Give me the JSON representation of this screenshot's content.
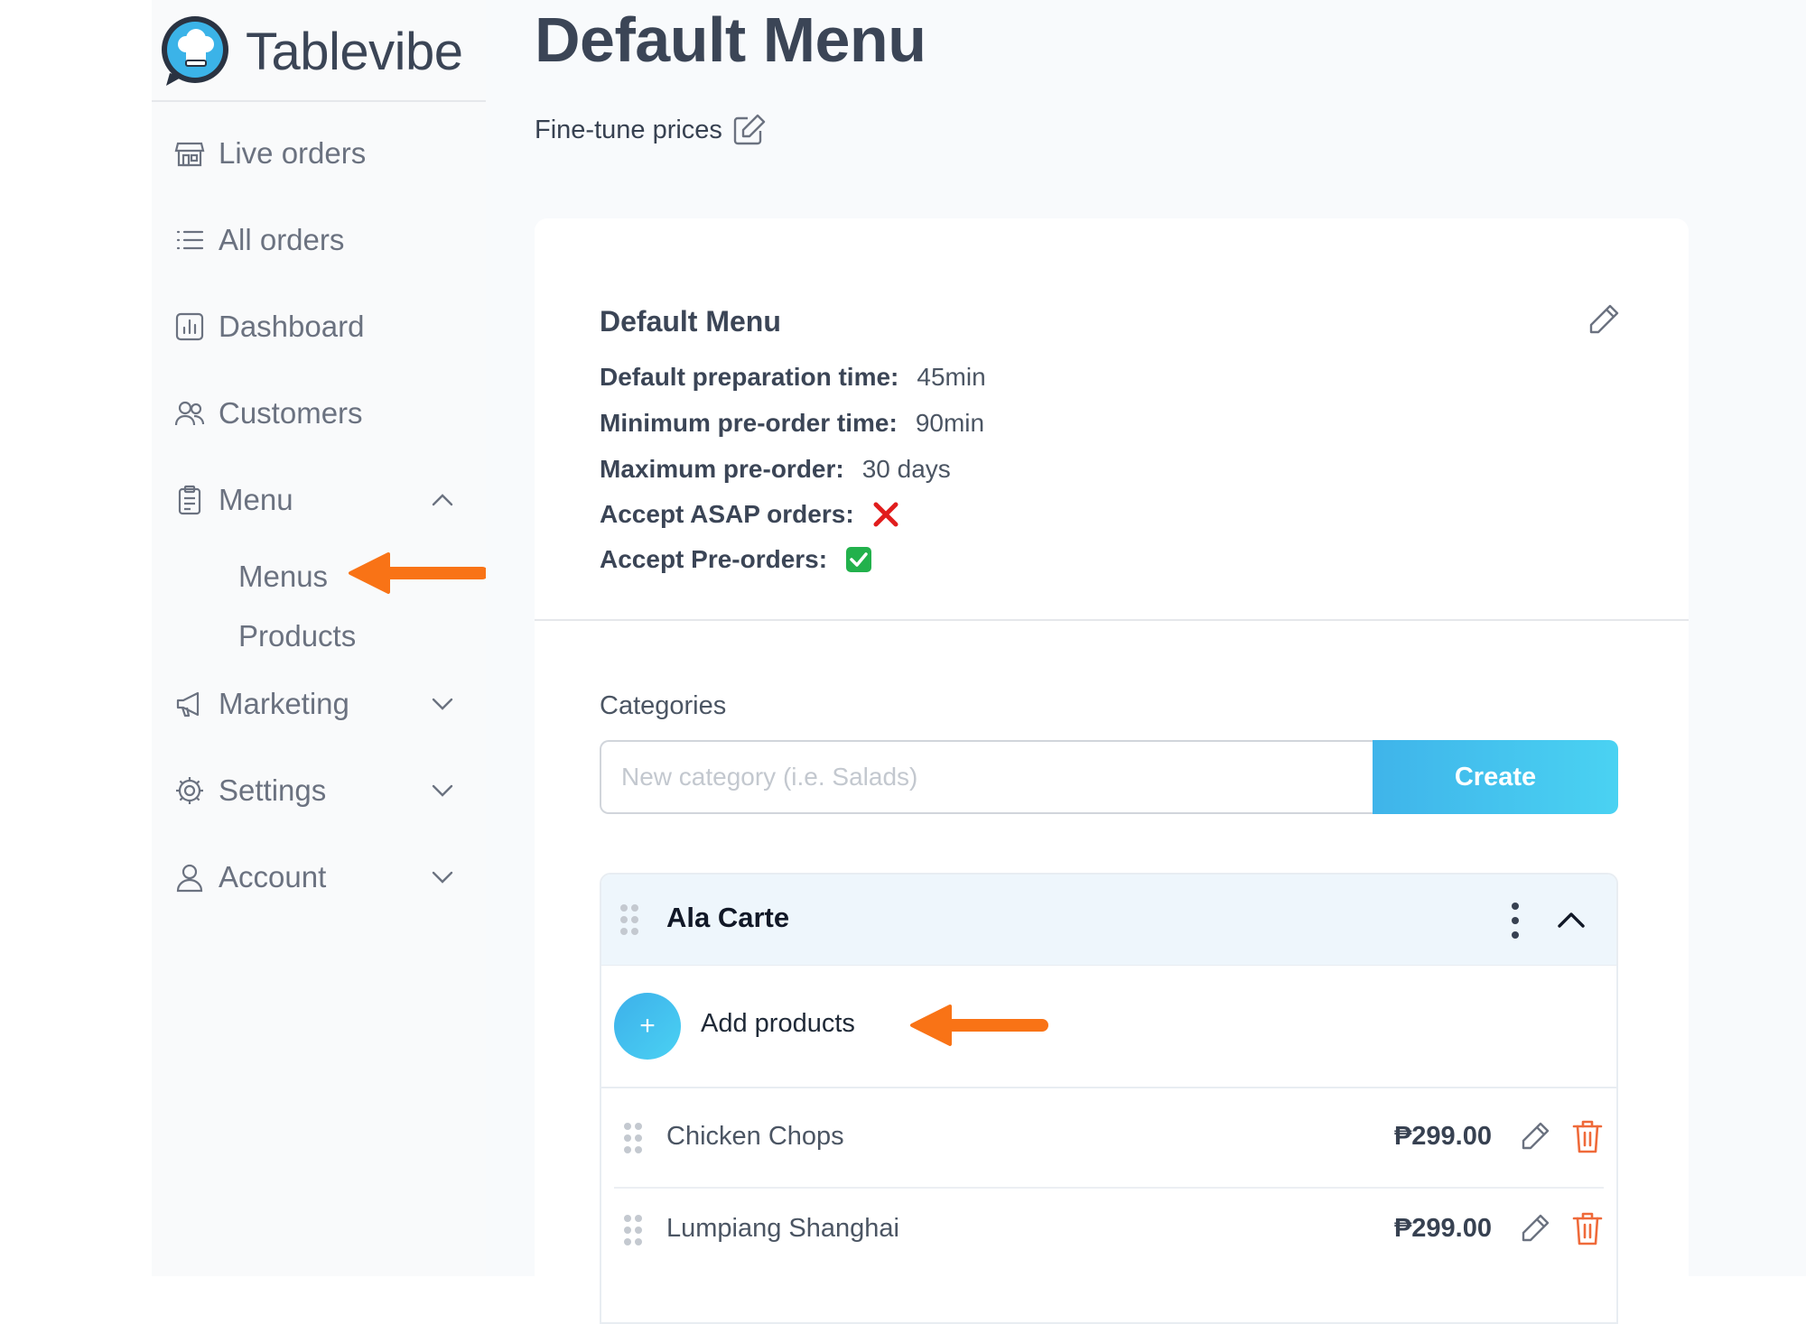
{
  "app": {
    "name": "Tablevibe"
  },
  "colors": {
    "accent": "#3fb4ea",
    "annotation_arrow": "#f97316",
    "delete": "#ef6a3a"
  },
  "sidebar": {
    "items": [
      {
        "label": "Live orders",
        "icon": "store-icon"
      },
      {
        "label": "All orders",
        "icon": "list-icon"
      },
      {
        "label": "Dashboard",
        "icon": "chart-icon"
      },
      {
        "label": "Customers",
        "icon": "users-icon"
      },
      {
        "label": "Menu",
        "icon": "clipboard-icon",
        "expanded": true,
        "children": [
          {
            "label": "Menus"
          },
          {
            "label": "Products"
          }
        ]
      },
      {
        "label": "Marketing",
        "icon": "megaphone-icon",
        "expanded": false
      },
      {
        "label": "Settings",
        "icon": "gear-icon",
        "expanded": false
      },
      {
        "label": "Account",
        "icon": "user-icon",
        "expanded": false
      }
    ]
  },
  "page": {
    "title": "Default Menu",
    "fine_tune_label": "Fine-tune prices"
  },
  "menu_card": {
    "title": "Default Menu",
    "details": [
      {
        "label": "Default preparation time:",
        "value": "45min"
      },
      {
        "label": "Minimum pre-order time:",
        "value": "90min"
      },
      {
        "label": "Maximum pre-order:",
        "value": "30 days"
      },
      {
        "label": "Accept ASAP orders:",
        "value": "",
        "status": "no"
      },
      {
        "label": "Accept Pre-orders:",
        "value": "",
        "status": "yes"
      }
    ]
  },
  "categories": {
    "label": "Categories",
    "input_placeholder": "New category (i.e. Salads)",
    "create_label": "Create",
    "add_icon_glyph": "+",
    "list": [
      {
        "name": "Ala Carte",
        "add_products_label": "Add products",
        "products": [
          {
            "name": "Chicken Chops",
            "price": "₱299.00"
          },
          {
            "name": "Lumpiang Shanghai",
            "price": "₱299.00"
          }
        ]
      }
    ]
  }
}
